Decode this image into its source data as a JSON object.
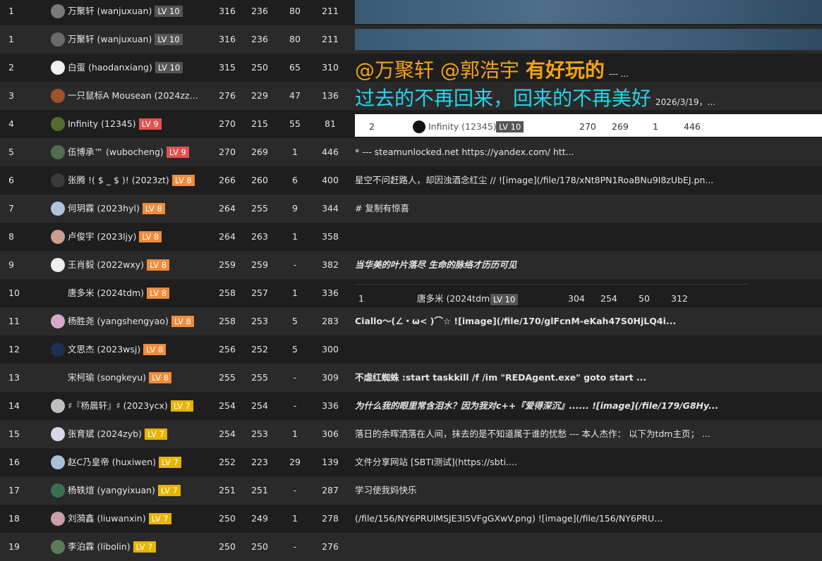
{
  "colors": {
    "lv10": "#555555",
    "lv9": "#e05252",
    "lv8": "#f08c3c",
    "lv7": "#e8b400",
    "gold": "#f3a312",
    "cyan": "#25d4e8"
  },
  "rows": [
    {
      "rank": "1",
      "name": "万聚轩 (wanjuxuan)",
      "lv": "LV 10",
      "lvclass": "lv10",
      "a": "316",
      "b": "236",
      "c": "80",
      "d": "211",
      "sig": ""
    },
    {
      "rank": "1",
      "name": "万聚轩 (wanjuxuan)",
      "lv": "LV 10",
      "lvclass": "lv10",
      "a": "316",
      "b": "236",
      "c": "80",
      "d": "211",
      "sig": ""
    },
    {
      "rank": "2",
      "name": "白蛋 (haodanxiang)",
      "lv": "LV 10",
      "lvclass": "lv10",
      "a": "315",
      "b": "250",
      "c": "65",
      "d": "310",
      "sig": ""
    },
    {
      "rank": "3",
      "name": "一只鼠标A Mousean (2024zz…",
      "lv": "",
      "lvclass": "lv10",
      "a": "276",
      "b": "229",
      "c": "47",
      "d": "136",
      "sig": ""
    },
    {
      "rank": "4",
      "name": "Infinity (12345)",
      "lv": "LV 9",
      "lvclass": "lv9",
      "a": "270",
      "b": "215",
      "c": "55",
      "d": "81",
      "sig": ""
    },
    {
      "rank": "5",
      "name": "伍博承™ (wubocheng)",
      "lv": "LV 9",
      "lvclass": "lv9",
      "a": "270",
      "b": "269",
      "c": "1",
      "d": "446",
      "sig": "* --- steamunlocked.net https://yandex.com/ htt..."
    },
    {
      "rank": "6",
      "name": "张腾 !( $ _ $ )! (2023zt)",
      "lv": "LV 8",
      "lvclass": "lv8",
      "a": "266",
      "b": "260",
      "c": "6",
      "d": "400",
      "sig": "星空不问赶路人，却因浊酒念红尘 // ![image](/file/178/xNt8PN1RoaBNu9I8zUbEJ.pn..."
    },
    {
      "rank": "7",
      "name": "何玥霖 (2023hyl)",
      "lv": "LV 8",
      "lvclass": "lv8",
      "a": "264",
      "b": "255",
      "c": "9",
      "d": "344",
      "sig": "# 复制有惊喜"
    },
    {
      "rank": "8",
      "name": "卢俊宇 (2023ljy)",
      "lv": "LV 8",
      "lvclass": "lv8",
      "a": "264",
      "b": "263",
      "c": "1",
      "d": "358",
      "sig": ""
    },
    {
      "rank": "9",
      "name": "王肖毅 (2022wxy)",
      "lv": "LV 8",
      "lvclass": "lv8",
      "a": "259",
      "b": "259",
      "c": "-",
      "d": "382",
      "sig": "当华美的叶片落尽 生命的脉络才历历可见"
    },
    {
      "rank": "10",
      "name": "唐多米 (2024tdm)",
      "lv": "LV 8",
      "lvclass": "lv8",
      "a": "258",
      "b": "257",
      "c": "1",
      "d": "336",
      "sig": ""
    },
    {
      "rank": "11",
      "name": "杨胜尧 (yangshengyao)",
      "lv": "LV 8",
      "lvclass": "lv8",
      "a": "258",
      "b": "253",
      "c": "5",
      "d": "283",
      "sig": "Ciallo～(∠・ω< )⌒☆ ![image](/file/170/glFcnM-eKah47S0HjLQ4i..."
    },
    {
      "rank": "12",
      "name": "文思杰 (2023wsj)",
      "lv": "LV 8",
      "lvclass": "lv8",
      "a": "256",
      "b": "252",
      "c": "5",
      "d": "300",
      "sig": ""
    },
    {
      "rank": "13",
      "name": "宋柯瑜 (songkeyu)",
      "lv": "LV 8",
      "lvclass": "lv8",
      "a": "255",
      "b": "255",
      "c": "-",
      "d": "309",
      "sig": "不虐红蜘蛛 :start taskkill /f /im \"REDAgent.exe\" goto start ..."
    },
    {
      "rank": "14",
      "name": "♯『杨晨轩』♯ (2023ycx)",
      "lv": "LV 7",
      "lvclass": "lv7",
      "a": "254",
      "b": "254",
      "c": "-",
      "d": "336",
      "sig": "为什么我的眼里常含泪水？因为我对c++『爱得深沉』...... ![image](/file/179/G8Hy..."
    },
    {
      "rank": "15",
      "name": "张育斌 (2024zyb)",
      "lv": "LV 7",
      "lvclass": "lv7",
      "a": "254",
      "b": "253",
      "c": "1",
      "d": "306",
      "sig": "落日的余晖洒落在人间，抹去的是不知道属于谁的忧愁 --- 本人杰作： 以下为tdm主页； ..."
    },
    {
      "rank": "16",
      "name": "赵C乃皇帝 (huxiwen)",
      "lv": "LV 7",
      "lvclass": "lv7",
      "a": "252",
      "b": "223",
      "c": "29",
      "d": "139",
      "sig": "文件分享网站 [SBTI测试](https://sbti...."
    },
    {
      "rank": "17",
      "name": "杨轶煊 (yangyixuan)",
      "lv": "LV 7",
      "lvclass": "lv7",
      "a": "251",
      "b": "251",
      "c": "-",
      "d": "287",
      "sig": "学习使我妈快乐"
    },
    {
      "rank": "18",
      "name": "刘漪鑫 (liuwanxin)",
      "lv": "LV 7",
      "lvclass": "lv7",
      "a": "250",
      "b": "249",
      "c": "1",
      "d": "278",
      "sig": "(/file/156/NY6PRUlMSJE3I5VFgGXwV.png) ![image](/file/156/NY6PRU..."
    },
    {
      "rank": "19",
      "name": "李泊霖 (libolin)",
      "lv": "LV 7",
      "lvclass": "lv7",
      "a": "250",
      "b": "250",
      "c": "-",
      "d": "276",
      "sig": ""
    }
  ],
  "banner": {
    "line1_a": "@万聚轩 @郭浩宇 ",
    "line1_b": "有好玩的",
    "line1_small": "--- ...",
    "line2": "过去的不再回来，回来的不再美好",
    "line2_small": "2026/3/19，..."
  },
  "embed1": {
    "rank": "2",
    "name": "Infinity (12345)",
    "lv": "LV 10",
    "a": "270",
    "b": "269",
    "c": "1",
    "d": "446"
  },
  "embed2": {
    "rank": "1",
    "name": "唐多米 (2024tdm)",
    "lv": "LV 10",
    "a": "304",
    "b": "254",
    "c": "50",
    "d": "312"
  }
}
